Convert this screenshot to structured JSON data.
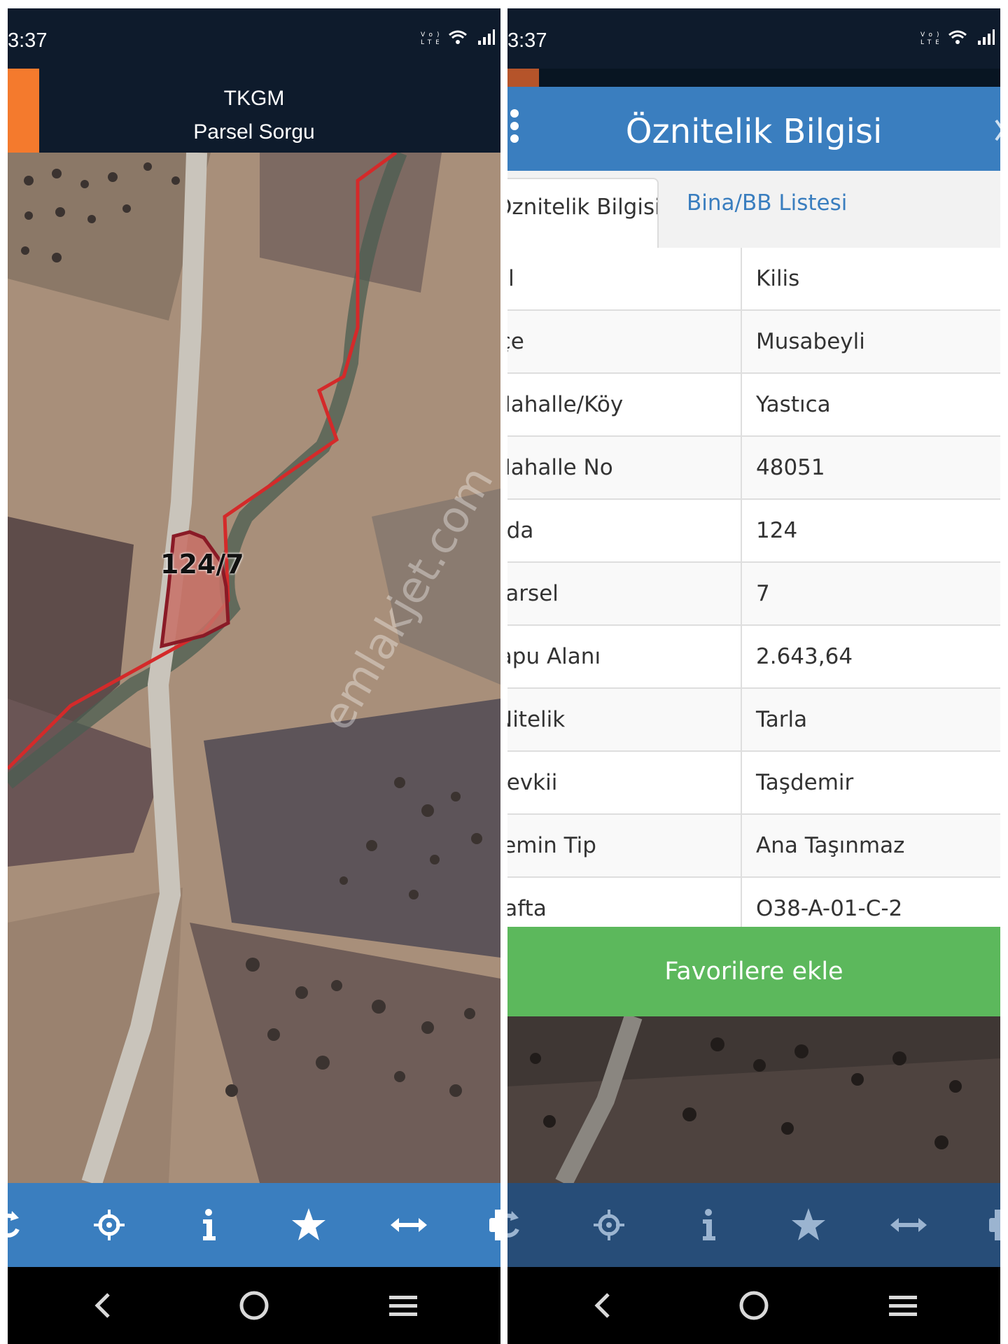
{
  "status_bar": {
    "time": "3:37",
    "icons": [
      "volte-lte-icon",
      "wifi-icon",
      "signal-icon"
    ]
  },
  "left": {
    "header": {
      "title": "TKGM",
      "subtitle": "Parsel Sorgu"
    },
    "map": {
      "parcel_label": "124/7",
      "watermark": "emlakjet.com"
    },
    "toolbar": [
      "refresh-icon",
      "crosshair-icon",
      "info-icon",
      "star-icon",
      "measure-icon",
      "print-icon"
    ]
  },
  "right": {
    "dialog_title": "Öznitelik Bilgisi",
    "tabs": [
      {
        "label": "Öznitelik Bilgisi",
        "active": true
      },
      {
        "label": "Bina/BB Listesi",
        "active": false
      }
    ],
    "rows": [
      {
        "key": "İl",
        "value": "Kilis"
      },
      {
        "key": "İlçe",
        "value": "Musabeyli"
      },
      {
        "key": "Mahalle/Köy",
        "value": "Yastıca"
      },
      {
        "key": "Mahalle No",
        "value": "48051"
      },
      {
        "key": "Ada",
        "value": "124"
      },
      {
        "key": "Parsel",
        "value": "7"
      },
      {
        "key": "Tapu Alanı",
        "value": "2.643,64"
      },
      {
        "key": "Nitelik",
        "value": "Tarla"
      },
      {
        "key": "Mevkii",
        "value": "Taşdemir"
      },
      {
        "key": "Zemin Tip",
        "value": "Ana Taşınmaz"
      },
      {
        "key": "Pafta",
        "value": "O38-A-01-C-2"
      }
    ],
    "favorite_button": "Favorilere ekle"
  },
  "colors": {
    "header_dark": "#0e1b2c",
    "orange": "#f47a2d",
    "blue": "#3a7ebf",
    "green": "#5cb85c",
    "parcel_line": "#d42a2a"
  }
}
